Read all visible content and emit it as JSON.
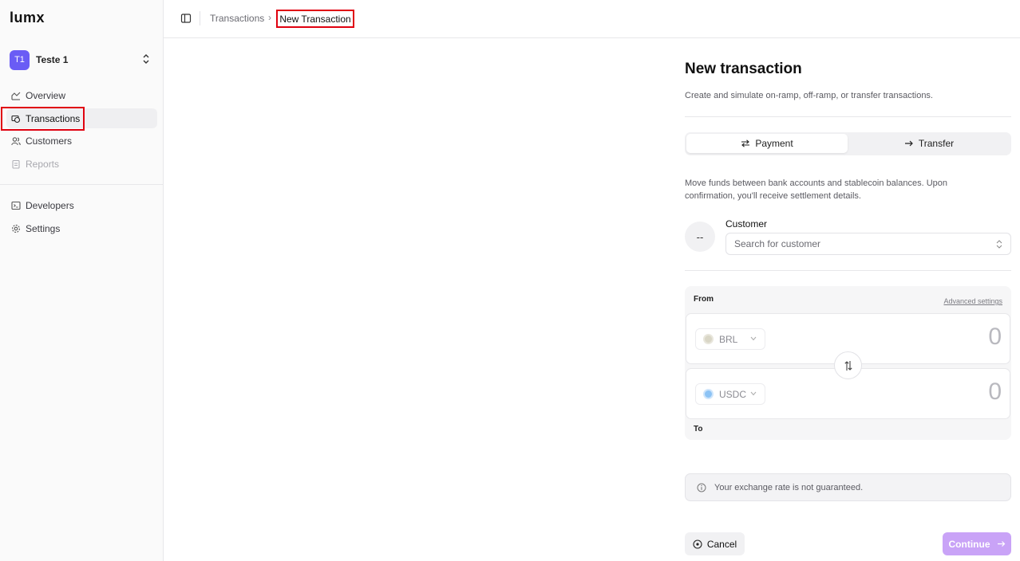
{
  "app": {
    "logo": "lumx"
  },
  "workspace": {
    "initials": "T1",
    "name": "Teste 1"
  },
  "sidebar": {
    "items": [
      {
        "label": "Overview",
        "icon": "overview-icon",
        "state": "default"
      },
      {
        "label": "Transactions",
        "icon": "transactions-icon",
        "state": "active"
      },
      {
        "label": "Customers",
        "icon": "customers-icon",
        "state": "default"
      },
      {
        "label": "Reports",
        "icon": "reports-icon",
        "state": "disabled"
      },
      {
        "label": "Developers",
        "icon": "terminal-icon",
        "state": "default"
      },
      {
        "label": "Settings",
        "icon": "gear-icon",
        "state": "default"
      }
    ]
  },
  "breadcrumb": {
    "parent": "Transactions",
    "current": "New Transaction"
  },
  "page": {
    "title": "New transaction",
    "subtitle": "Create and simulate on-ramp, off-ramp, or transfer transactions."
  },
  "tabs": [
    {
      "label": "Payment",
      "icon": "swap-arrows-icon",
      "selected": true
    },
    {
      "label": "Transfer",
      "icon": "arrow-right-icon",
      "selected": false
    }
  ],
  "description": "Move funds between bank accounts and stablecoin balances. Upon confirmation, you'll receive settlement details.",
  "customer": {
    "avatar_text": "--",
    "label": "Customer",
    "placeholder": "Search for customer"
  },
  "conversion": {
    "from_label": "From",
    "to_label": "To",
    "advanced_label": "Advanced settings",
    "from_currency": "BRL",
    "from_amount": "0",
    "to_currency": "USDC",
    "to_amount": "0"
  },
  "notice": "Your exchange rate is not guaranteed.",
  "actions": {
    "cancel_label": "Cancel",
    "continue_label": "Continue"
  },
  "colors": {
    "accent": "#6a5cf5",
    "continue_disabled": "#c9a3f7",
    "highlight": "#e0000f"
  }
}
